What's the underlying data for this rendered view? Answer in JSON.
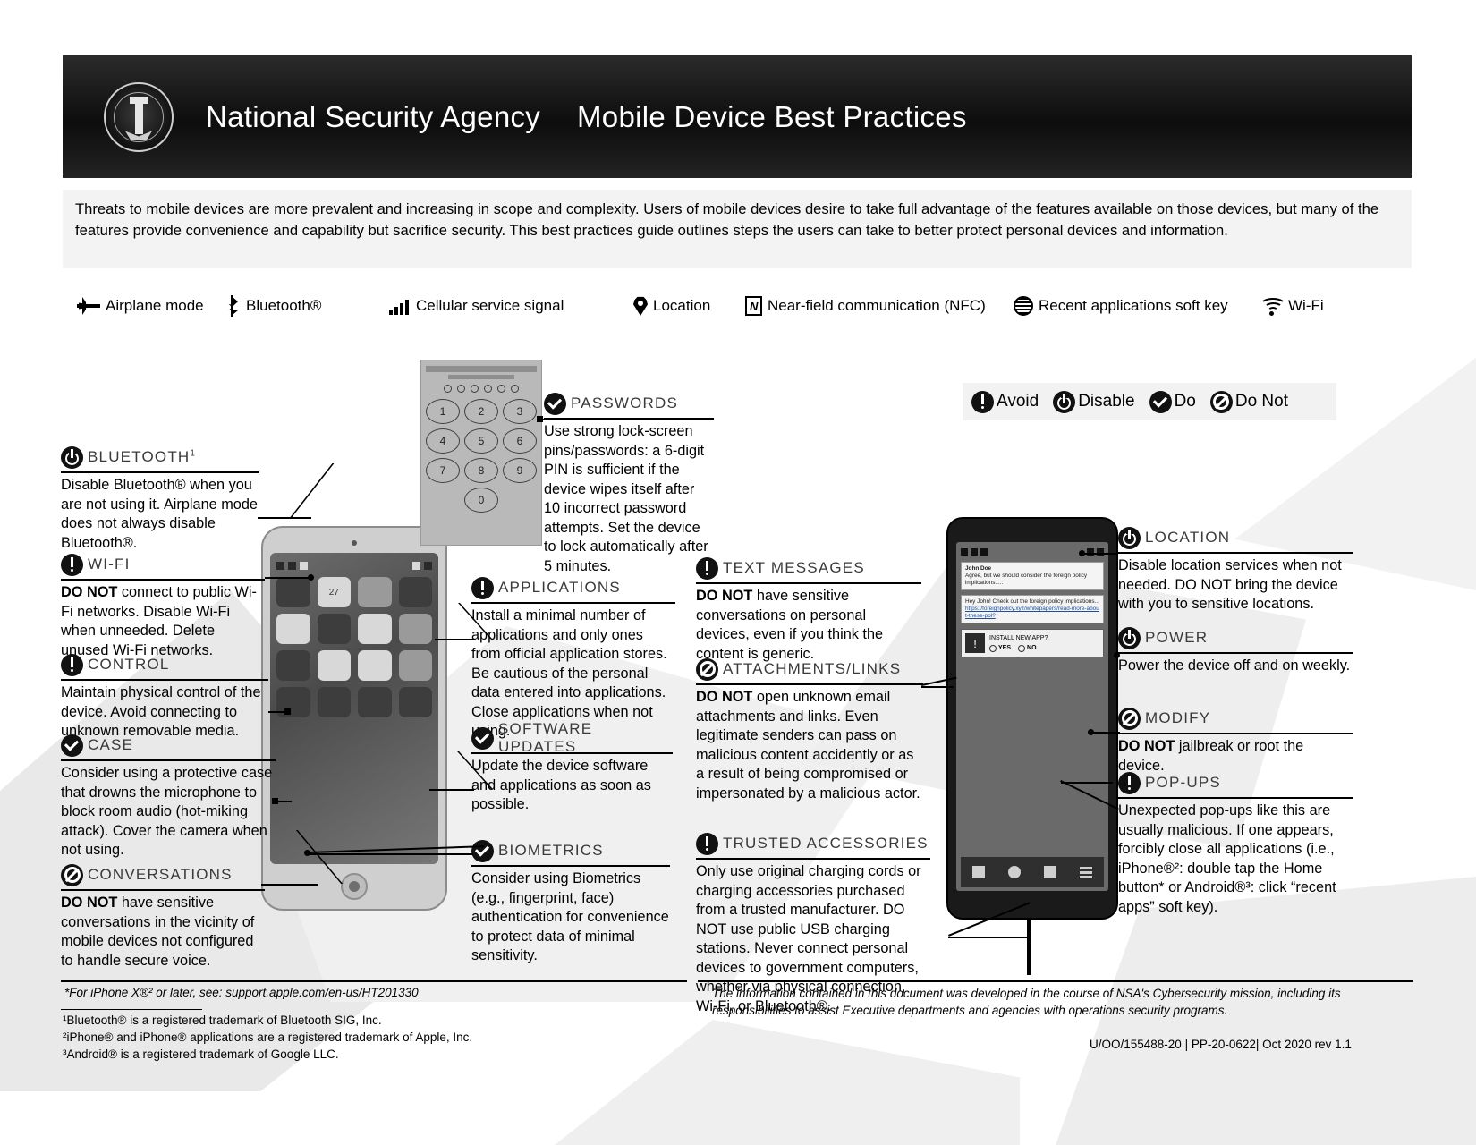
{
  "header": {
    "org": "National Security Agency",
    "title": "Mobile Device Best Practices",
    "seal_name": "nsa-seal"
  },
  "intro": {
    "text": "Threats to mobile devices are more prevalent and increasing in scope and complexity. Users of mobile devices desire to take full advantage of the features available on those devices, but many of the features provide convenience and capability but sacrifice security. This best practices guide outlines steps the users can take to better protect personal devices and information."
  },
  "icon_legend": [
    {
      "icon": "airplane-mode-icon",
      "label": "Airplane mode"
    },
    {
      "icon": "bluetooth-icon",
      "label": "Bluetooth®"
    },
    {
      "icon": "cellular-signal-icon",
      "label": "Cellular service signal"
    },
    {
      "icon": "location-pin-icon",
      "label": "Location"
    },
    {
      "icon": "nfc-icon",
      "label": "Near-field communication (NFC)"
    },
    {
      "icon": "recent-apps-icon",
      "label": "Recent applications soft key"
    },
    {
      "icon": "wifi-icon",
      "label": "Wi-Fi"
    }
  ],
  "status_legend": [
    {
      "icon": "avoid-icon",
      "label": "Avoid"
    },
    {
      "icon": "disable-icon",
      "label": "Disable"
    },
    {
      "icon": "do-icon",
      "label": "Do"
    },
    {
      "icon": "do-not-icon",
      "label": "Do Not"
    }
  ],
  "callouts": {
    "bluetooth": {
      "title": "BLUETOOTH",
      "sup": "1",
      "badge": "disable-icon",
      "body": "Disable Bluetooth® when you are not using it. Airplane mode does not always disable Bluetooth®."
    },
    "wifi": {
      "title": "WI-FI",
      "badge": "avoid-icon",
      "body_bold": "DO NOT",
      "body": " connect to public Wi-Fi networks. Disable Wi-Fi when unneeded. Delete unused Wi-Fi networks."
    },
    "control": {
      "title": "CONTROL",
      "badge": "avoid-icon",
      "body": "Maintain physical control of the device. Avoid connecting to unknown removable media."
    },
    "case": {
      "title": "CASE",
      "badge": "do-icon",
      "body": "Consider using a protective case that drowns the microphone to block room audio (hot-miking attack). Cover the camera when not using."
    },
    "conversations": {
      "title": "CONVERSATIONS",
      "badge": "do-not-icon",
      "body_bold": "DO NOT",
      "body": " have sensitive conversations in the vicinity of mobile devices not configured to handle secure voice."
    },
    "passwords": {
      "title": "PASSWORDS",
      "badge": "do-icon",
      "body": "Use strong lock-screen pins/passwords: a 6-digit PIN is sufficient if the device wipes itself after 10 incorrect password attempts. Set the device to lock automatically after 5 minutes."
    },
    "applications": {
      "title": "APPLICATIONS",
      "badge": "avoid-icon",
      "body": "Install a minimal number of applications and only ones from official application stores. Be cautious of the personal data entered into applications. Close applications when not using."
    },
    "software_updates": {
      "title": "SOFTWARE UPDATES",
      "badge": "do-icon",
      "body": "Update the device software and applications as soon as possible."
    },
    "biometrics": {
      "title": "BIOMETRICS",
      "badge": "do-icon",
      "body": "Consider using Biometrics (e.g., fingerprint, face) authentication for convenience to protect data of minimal sensitivity."
    },
    "text_messages": {
      "title": "TEXT MESSAGES",
      "badge": "avoid-icon",
      "body_bold": "DO NOT",
      "body": " have sensitive conversations on personal devices, even if you think the content is generic."
    },
    "attachments_links": {
      "title": "ATTACHMENTS/LINKS",
      "badge": "do-not-icon",
      "body_bold": "DO NOT",
      "body": " open unknown email attachments and links. Even legitimate senders can pass on malicious content accidently or as a result of being compromised or impersonated by a malicious actor."
    },
    "trusted_accessories": {
      "title": "TRUSTED ACCESSORIES",
      "badge": "avoid-icon",
      "body": "Only use original charging cords or charging accessories purchased from a trusted manufacturer. DO NOT use public USB charging stations. Never connect personal devices to government computers, whether via physical connection, Wi-Fi, or Bluetooth®."
    },
    "location": {
      "title": "LOCATION",
      "badge": "disable-icon",
      "body": "Disable location services when not needed. DO NOT bring the device with you to sensitive locations."
    },
    "power": {
      "title": "POWER",
      "badge": "disable-icon",
      "body": "Power the device off and on weekly."
    },
    "modify": {
      "title": "MODIFY",
      "badge": "do-not-icon",
      "body_bold": "DO NOT",
      "body": " jailbreak or root the device."
    },
    "popups": {
      "title": "POP-UPS",
      "badge": "avoid-icon",
      "body": "Unexpected pop-ups like this are usually malicious. If one appears, forcibly close all applications (i.e., iPhone®²: double tap the Home button* or Android®³: click “recent apps” soft key)."
    }
  },
  "device_left": {
    "status_time": "",
    "keypad_keys": [
      "1",
      "2",
      "3",
      "4",
      "5",
      "6",
      "7",
      "8",
      "9",
      "0"
    ],
    "app_labels": [
      "",
      "27",
      "",
      "",
      "",
      "",
      "",
      "",
      "",
      "",
      "",
      "",
      "",
      "",
      "",
      ""
    ]
  },
  "device_right": {
    "msg1_name": "John Doe",
    "msg1_text": "Agree, but we should consider the foreign policy implications.....",
    "msg2_text": "Hey John! Check out the foreign policy implications...",
    "msg2_link1": "https://foreignpolicy.xyz/whitepapers/read-more-about-these-pol?",
    "popup_title": "INSTALL NEW APP?",
    "popup_yes": "YES",
    "popup_no": "NO",
    "popup_warn_glyph": "!"
  },
  "footer": {
    "apple_note": "*For iPhone X®² or later, see: support.apple.com/en-us/HT201330",
    "tm1": "¹Bluetooth® is a registered trademark of Bluetooth SIG, Inc.",
    "tm2": "²iPhone® and iPhone® applications are a registered trademark of Apple, Inc.",
    "tm3": "³Android® is a registered trademark of Google LLC.",
    "disclaimer": "The information contained in this document was developed in the course of NSA's Cybersecurity mission, including its responsibilities to assist Executive departments and agencies with operations security programs.",
    "docid": "U/OO/155488-20 | PP-20-0622| Oct 2020 rev 1.1"
  },
  "colors": {
    "banner_bg": "#111111",
    "intro_bg": "#f3f3f3",
    "rule": "#000000",
    "title_grey": "#3a3a3a"
  }
}
